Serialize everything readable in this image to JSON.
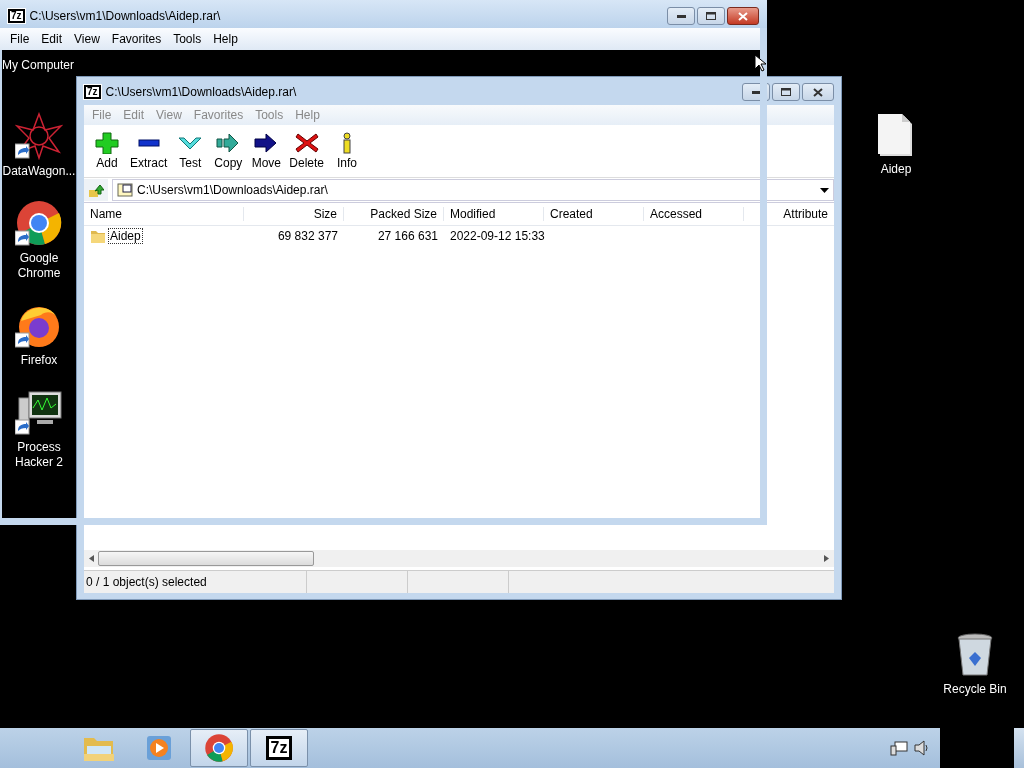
{
  "desktop": {
    "my_computer_label": "My Computer",
    "left_icons": [
      {
        "label": "DataWagon...",
        "kind": "datawagon"
      },
      {
        "label": "Google Chrome",
        "kind": "chrome"
      },
      {
        "label": "Firefox",
        "kind": "firefox"
      },
      {
        "label": "Process Hacker 2",
        "kind": "monitor"
      }
    ],
    "file_icon": {
      "label": "Aidep"
    },
    "recycle_bin": {
      "label": "Recycle Bin"
    }
  },
  "back_window": {
    "badge": "7z",
    "title": "C:\\Users\\vm1\\Downloads\\Aidep.rar\\",
    "active": false,
    "menu": [
      "File",
      "Edit",
      "View",
      "Favorites",
      "Tools",
      "Help"
    ],
    "toolbar": [
      {
        "label": "Add",
        "kind": "add"
      },
      {
        "label": "Extract",
        "kind": "extract"
      },
      {
        "label": "Test",
        "kind": "test"
      },
      {
        "label": "Copy",
        "kind": "copy"
      },
      {
        "label": "Move",
        "kind": "move"
      },
      {
        "label": "Delete",
        "kind": "delete"
      },
      {
        "label": "Info",
        "kind": "info"
      }
    ],
    "address": "C:\\Users\\vm1\\Downloads\\Aidep.rar\\",
    "columns": [
      "Name",
      "Size",
      "Packed Size",
      "Modified",
      "Created",
      "Accessed",
      "Attribute"
    ],
    "rows": [
      {
        "name": "Aidep",
        "size": "69 832 377",
        "packed_size": "27 166 631",
        "modified": "2022-09-12 15:33",
        "selected": false,
        "focused": true
      }
    ],
    "status": "0 / 1 object(s) selected"
  },
  "front_window": {
    "badge": "7z",
    "title": "C:\\Users\\vm1\\Downloads\\Aidep.rar\\",
    "active": true,
    "menu": [
      "File",
      "Edit",
      "View",
      "Favorites",
      "Tools",
      "Help"
    ]
  },
  "taskbar": {
    "items": [
      {
        "kind": "explorer",
        "selected": false
      },
      {
        "kind": "media",
        "selected": false
      },
      {
        "kind": "chrome",
        "selected": true
      },
      {
        "kind": "sevenzip",
        "badge": "7z",
        "selected": true
      }
    ]
  }
}
